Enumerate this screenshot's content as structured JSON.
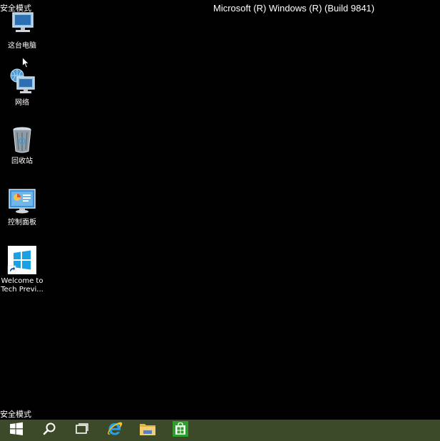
{
  "watermark": {
    "top_left": "安全模式",
    "top_center": "Microsoft (R) Windows (R) (Build 9841)",
    "bottom_left": "安全模式"
  },
  "desktop_icons": [
    {
      "label": "这台电脑",
      "icon": "computer-icon"
    },
    {
      "label": "网络",
      "icon": "network-icon"
    },
    {
      "label": "回收站",
      "icon": "recycle-bin-icon"
    },
    {
      "label": "控制面板",
      "icon": "control-panel-icon"
    },
    {
      "label": "Welcome to Tech Previ...",
      "icon": "windows-shortcut-icon"
    }
  ],
  "taskbar": {
    "items": [
      {
        "name": "start",
        "icon": "windows-logo-icon"
      },
      {
        "name": "search",
        "icon": "search-icon"
      },
      {
        "name": "task-view",
        "icon": "task-view-icon"
      },
      {
        "name": "internet-explorer",
        "icon": "internet-explorer-icon"
      },
      {
        "name": "file-explorer",
        "icon": "folder-icon"
      },
      {
        "name": "store",
        "icon": "store-icon"
      }
    ]
  },
  "colors": {
    "desktop_background": "#010101",
    "taskbar_background": "#3d4a2a",
    "windows_blue": "#1ba1e2",
    "store_green": "#2e9e2e"
  }
}
